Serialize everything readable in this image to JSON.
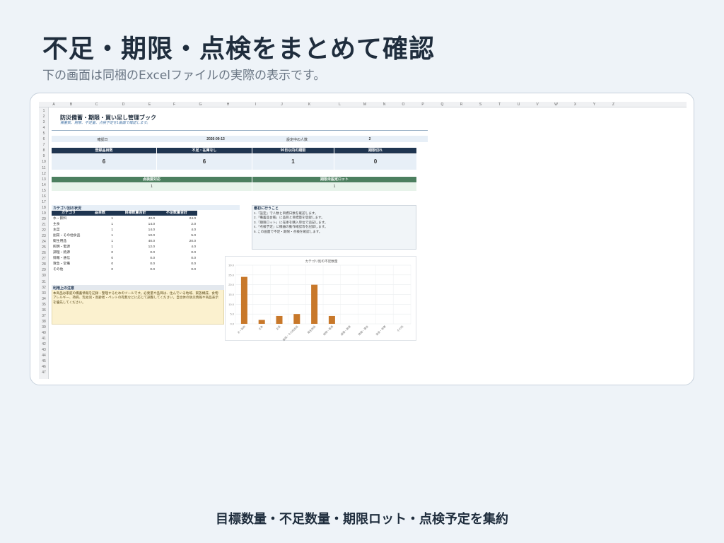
{
  "hero": {
    "title": "不足・期限・点検をまとめて確認",
    "subtitle": "下の画面は同梱のExcelファイルの実際の表示です。"
  },
  "footer": {
    "caption": "目標数量・不足数量・期限ロット・点検予定を集約"
  },
  "sheet": {
    "columns": [
      "A",
      "B",
      "C",
      "D",
      "E",
      "F",
      "G",
      "H",
      "I",
      "J",
      "K",
      "L",
      "M",
      "N",
      "O",
      "P",
      "Q",
      "R",
      "S",
      "T",
      "U",
      "V",
      "W",
      "X",
      "Y",
      "Z"
    ],
    "rows": [
      "1",
      "2",
      "3",
      "4",
      "5",
      "6",
      "7",
      "8",
      "9",
      "10",
      "11",
      "12",
      "13",
      "14",
      "15",
      "16",
      "17",
      "18",
      "19",
      "20",
      "21",
      "22",
      "23",
      "24",
      "25",
      "26",
      "27",
      "28",
      "29",
      "30",
      "31",
      "32",
      "33",
      "34",
      "35",
      "36",
      "37",
      "38",
      "39",
      "40",
      "41",
      "42",
      "43",
      "44",
      "45",
      "46",
      "47"
    ],
    "title": "防災備蓄・期限・買い足し管理ブック",
    "subtitle": "備蓄数、期限、不足量、点検予定を1画面で確認します。",
    "check_date_label": "確認日",
    "check_date": "2026-09-13",
    "people_label": "設定中の人数",
    "people": "2",
    "kpis": [
      {
        "label": "登録品目数",
        "value": "6"
      },
      {
        "label": "不足・在庫なし",
        "value": "6"
      },
      {
        "label": "90日以内の期限",
        "value": "1"
      },
      {
        "label": "期限切れ",
        "value": "0"
      }
    ],
    "kpis2": [
      {
        "label": "点検要対応",
        "value": "1"
      },
      {
        "label": "期限未設定ロット",
        "value": "1"
      }
    ],
    "category": {
      "heading": "カテゴリ別の状況",
      "headers": [
        "カテゴリ",
        "品目数",
        "目標数量合計",
        "不足数量合計"
      ],
      "rows": [
        [
          "水・飲料",
          "1",
          "42.0",
          "24.0"
        ],
        [
          "主食",
          "1",
          "14.0",
          "2.0"
        ],
        [
          "主菜",
          "1",
          "14.0",
          "4.0"
        ],
        [
          "副菜・その他食品",
          "1",
          "10.0",
          "5.0"
        ],
        [
          "衛生用品",
          "1",
          "40.0",
          "20.0"
        ],
        [
          "照明・電源",
          "1",
          "12.0",
          "4.0"
        ],
        [
          "調理・熱源",
          "0",
          "0.0",
          "0.0"
        ],
        [
          "情報・通信",
          "0",
          "0.0",
          "0.0"
        ],
        [
          "救急・常備",
          "0",
          "0.0",
          "0.0"
        ],
        [
          "その他",
          "0",
          "0.0",
          "0.0"
        ]
      ]
    },
    "first_steps": {
      "heading": "最初に行うこと",
      "items": [
        "1.「設定」で人数と目標日数を確認します。",
        "2.「備蓄品台帳」に品目と目標量を登録します。",
        "3.「期限ロット」に在庫を購入単位で追記します。",
        "4.「点検予定」に機器の動作確認等を記録します。",
        "5. この画面で不足・期限・点検を確認します。"
      ]
    },
    "notes": {
      "heading": "利用上の注意",
      "body": "本商品は家庭の備蓄情報を記録・整理するためのツールです。必要量や品目は、住んでいる地域、家族構成、食物アレルギー、持病、乳幼児・高齢者・ペットの有無などに応じて調整してください。自治体の防災情報や商品表示を優先してください。"
    }
  },
  "chart_data": {
    "type": "bar",
    "title": "カテゴリ別の不足数量",
    "categories": [
      "水・飲料",
      "主食",
      "主菜",
      "副菜・その他食品",
      "衛生用品",
      "照明・電源",
      "調理・熱源",
      "情報・通信",
      "救急・常備",
      "その他"
    ],
    "values": [
      24.0,
      2.0,
      4.0,
      5.0,
      20.0,
      4.0,
      0.0,
      0.0,
      0.0,
      0.0
    ],
    "yticks": [
      "0.0",
      "5.0",
      "10.0",
      "15.0",
      "20.0",
      "25.0",
      "30.0"
    ],
    "ylim": [
      0,
      30
    ],
    "grid": true,
    "bar_color": "#c8782a"
  }
}
